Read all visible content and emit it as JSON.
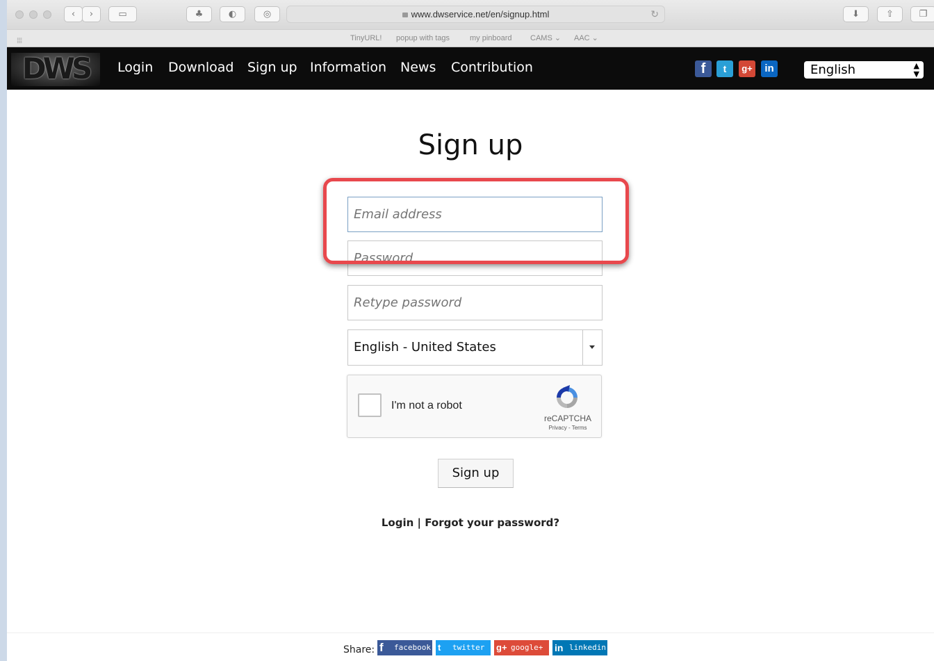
{
  "browser": {
    "url": "www.dwservice.net/en/signup.html",
    "bookmarks": [
      "TinyURL!",
      "popup with tags",
      "my pinboard",
      "CAMS ⌄",
      "AAC ⌄"
    ]
  },
  "nav": {
    "logo": "DWS",
    "links": [
      "Login",
      "Download",
      "Sign up",
      "Information",
      "News",
      "Contribution"
    ],
    "social": [
      "f",
      "t",
      "g+",
      "in"
    ],
    "language": "English"
  },
  "form": {
    "title": "Sign up",
    "email_placeholder": "Email address",
    "password_placeholder": "Password",
    "retype_placeholder": "Retype password",
    "locale_value": "English - United States",
    "captcha_label": "I'm not a robot",
    "captcha_brand": "reCAPTCHA",
    "captcha_terms": "Privacy - Terms",
    "submit_label": "Sign up",
    "login_link": "Login",
    "separator": "|",
    "forgot_link": "Forgot your password?"
  },
  "footer": {
    "share_label": "Share:",
    "buttons": [
      {
        "icon": "f",
        "label": "facebook",
        "color": "#3b5998"
      },
      {
        "icon": "t",
        "label": "twitter",
        "color": "#1da1f2"
      },
      {
        "icon": "g+",
        "label": "google+",
        "color": "#dd4b39"
      },
      {
        "icon": "in",
        "label": "linkedin",
        "color": "#0077b5"
      }
    ]
  },
  "colors": {
    "highlight": "#e8484d",
    "nav_bg": "#0c0c0c"
  }
}
